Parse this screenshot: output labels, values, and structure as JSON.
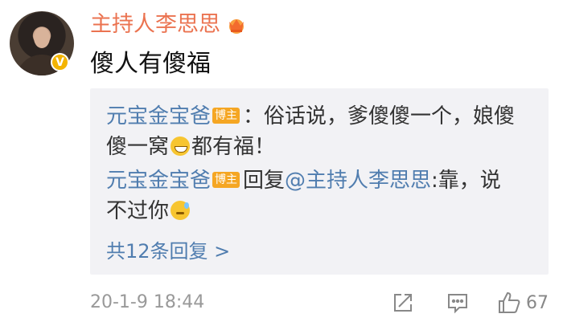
{
  "post": {
    "author": "主持人李思思",
    "content": "傻人有傻福",
    "time": "20-1-9 18:44",
    "likes": "67"
  },
  "replies": [
    {
      "name": "元宝金宝爸",
      "badge": "博主",
      "text_a": "：俗话说，爹傻傻一个，娘傻",
      "text_b": "傻一窝",
      "text_c": "都有福！",
      "emoji": "grin-emoji"
    },
    {
      "name": "元宝金宝爸",
      "badge": "博主",
      "reply_word": "回复",
      "mention": "@主持人李思思",
      "text_a": ":靠，说",
      "text_b": "不过你",
      "emoji": "sweat-emoji"
    }
  ],
  "more_replies": "共12条回复 >",
  "icons": {
    "avatar_badge": "verified-icon",
    "crown": "crown-icon",
    "share": "share-icon",
    "comment": "comment-icon",
    "like": "thumbs-up-icon"
  },
  "colors": {
    "author": "#eb7350",
    "link": "#507daf",
    "reply_bg": "#f2f2f5",
    "badge": "#f5a623",
    "verified": "#f4b400"
  }
}
